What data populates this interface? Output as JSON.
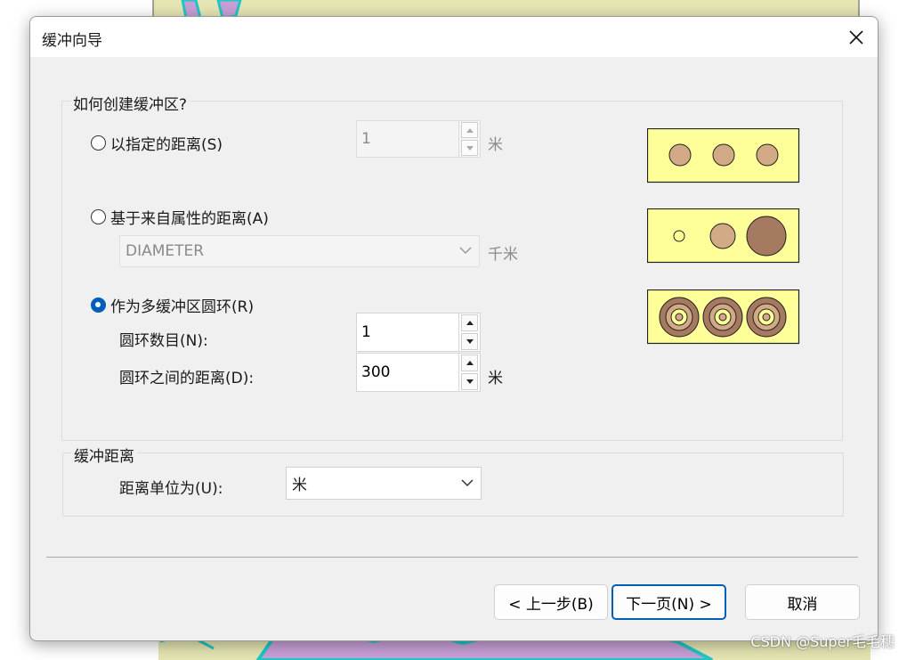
{
  "window": {
    "title": "缓冲向导"
  },
  "section_create": {
    "title": "如何创建缓冲区?",
    "option_specified": {
      "label": "以指定的距离(S)",
      "value": "1",
      "unit": "米",
      "selected": false
    },
    "option_attribute": {
      "label": "基于来自属性的距离(A)",
      "field": "DIAMETER",
      "unit": "千米",
      "selected": false
    },
    "option_rings": {
      "label": "作为多缓冲区圆环(R)",
      "selected": true,
      "ring_count_label": "圆环数目(N):",
      "ring_count": "1",
      "ring_distance_label": "圆环之间的距离(D):",
      "ring_distance": "300",
      "ring_distance_unit": "米"
    }
  },
  "section_distance": {
    "title": "缓冲距离",
    "unit_label": "距离单位为(U):",
    "unit_value": "米"
  },
  "buttons": {
    "back": "< 上一步(B)",
    "next": "下一页(N) >",
    "cancel": "取消"
  },
  "watermark": "CSDN @Super毛毛穗",
  "colors": {
    "preview_bg": "#ffff99",
    "circle_fill": "#d2ab86",
    "circle_dark": "#a57a60",
    "accent": "#005fb8",
    "map_land": "#e6e6b4",
    "map_region": "#c8a0d7",
    "map_lines": "#1fc8c8"
  }
}
